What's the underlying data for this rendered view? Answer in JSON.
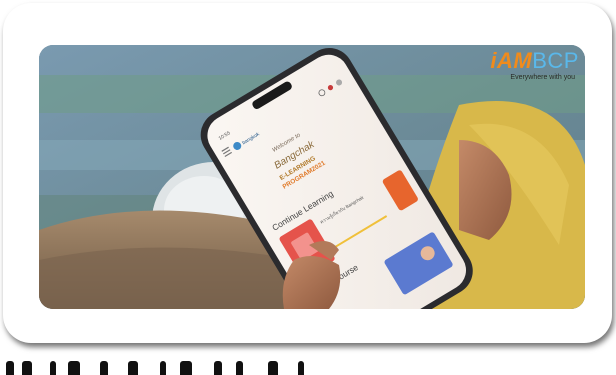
{
  "brand": {
    "mark_part1": "iAM",
    "mark_part2": "BCP",
    "tagline": "Everywhere with you",
    "colors": {
      "orange": "#f08b1c",
      "blue": "#5ab8ea"
    }
  },
  "phone_screen": {
    "status_time": "10:55",
    "app_logo": "bangkok",
    "welcome": "Welcome to",
    "script_title": "Bangchak",
    "program_line1": "E-LEARNING",
    "program_line2": "PROGRAM2021",
    "continue_heading": "Continue Learning",
    "course_caption": "ความรู้เกี่ยวกับ Bangchak",
    "latest_heading": "Latest Course"
  },
  "icons": [
    "menu-icon",
    "search-icon",
    "bell-icon",
    "user-icon"
  ]
}
